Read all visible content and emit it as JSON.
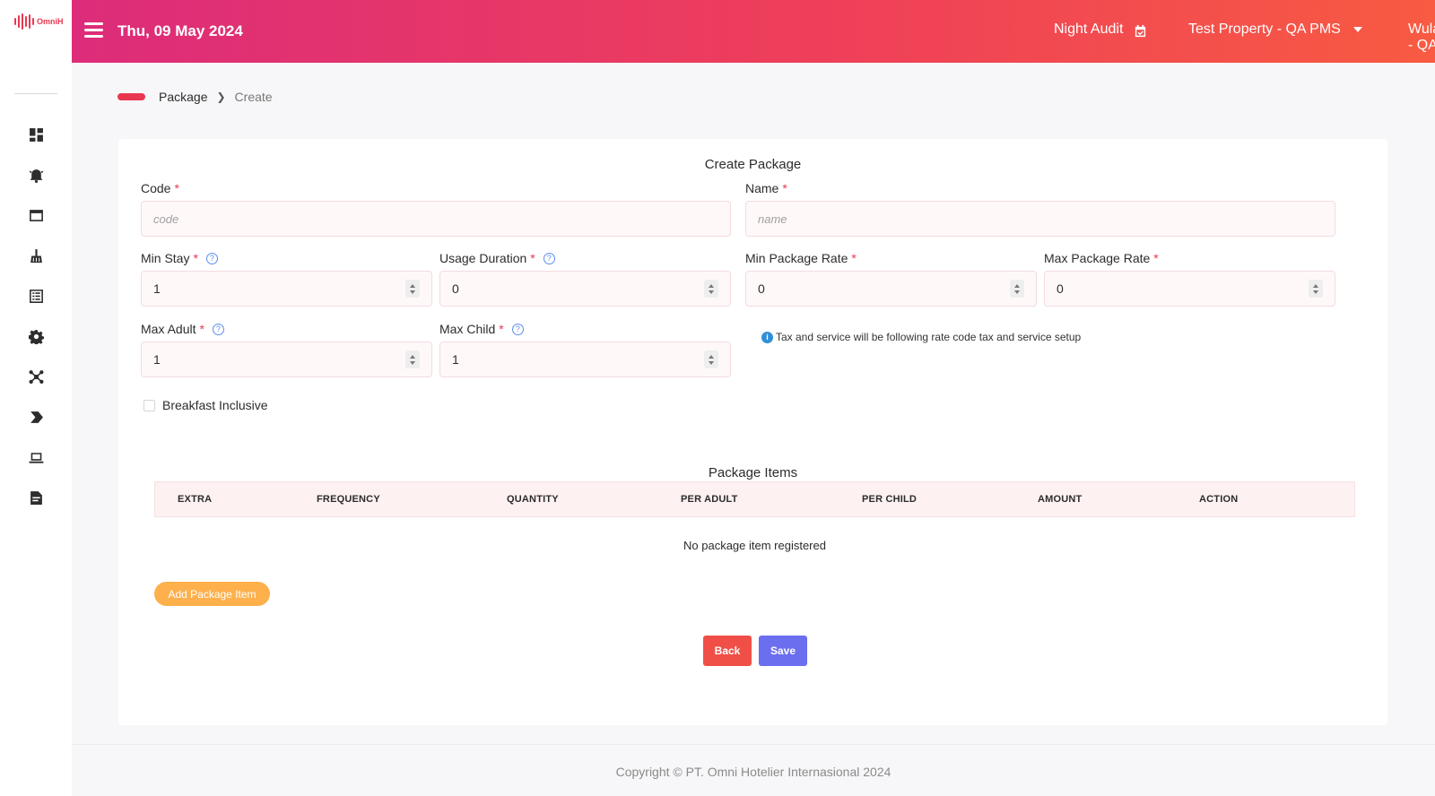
{
  "brand": {
    "name": "OmniH",
    "accent": "#e8384f"
  },
  "sidebar": {
    "items": [
      {
        "icon": "dashboard-icon"
      },
      {
        "icon": "bell-concierge-icon"
      },
      {
        "icon": "window-icon"
      },
      {
        "icon": "broom-housekeeping-icon"
      },
      {
        "icon": "list-icon"
      },
      {
        "icon": "gear-icon"
      },
      {
        "icon": "network-icon"
      },
      {
        "icon": "chevron-right-icon"
      },
      {
        "icon": "laptop-icon"
      },
      {
        "icon": "report-file-icon"
      }
    ]
  },
  "header": {
    "date": "Thu, 09 May 2024",
    "night_audit": "Night Audit",
    "property": "Test Property - QA PMS",
    "user": "Wulan - QA"
  },
  "breadcrumb": {
    "parent": "Package",
    "current": "Create"
  },
  "form": {
    "title": "Create Package",
    "code": {
      "label": "Code",
      "placeholder": "code"
    },
    "name": {
      "label": "Name",
      "placeholder": "name"
    },
    "min_stay": {
      "label": "Min Stay",
      "value": "1"
    },
    "usage_duration": {
      "label": "Usage Duration",
      "value": "0"
    },
    "min_package_rate": {
      "label": "Min Package Rate",
      "value": "0"
    },
    "max_package_rate": {
      "label": "Max Package Rate",
      "value": "0"
    },
    "max_adult": {
      "label": "Max Adult",
      "value": "1"
    },
    "max_child": {
      "label": "Max Child",
      "value": "1"
    },
    "tax_note": "Tax and service will be following rate code tax and service setup",
    "breakfast_label": "Breakfast Inclusive",
    "breakfast_checked": false
  },
  "package_items": {
    "title": "Package Items",
    "columns": [
      "EXTRA",
      "FREQUENCY",
      "QUANTITY",
      "PER ADULT",
      "PER CHILD",
      "AMOUNT",
      "ACTION"
    ],
    "empty_message": "No package item registered",
    "add_button": "Add Package Item"
  },
  "actions": {
    "back": "Back",
    "save": "Save"
  },
  "footer": {
    "copyright": "Copyright © PT. Omni Hotelier Internasional 2024"
  }
}
